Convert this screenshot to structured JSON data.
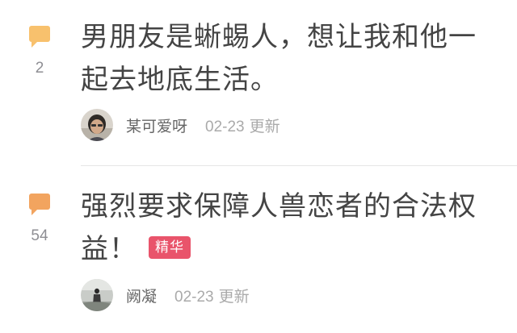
{
  "threads": [
    {
      "reply_icon": "comment-bubble-icon",
      "reply_count": "2",
      "title": "男朋友是蜥蜴人，想让我和他一起去地底生活。",
      "badge": "",
      "author": "某可爱呀",
      "date": "02-23",
      "updated_label": "更新"
    },
    {
      "reply_icon": "comment-bubble-icon",
      "reply_count": "54",
      "title": "强烈要求保障人兽恋者的合法权益！",
      "badge": "精华",
      "author": "阙凝",
      "date": "02-23",
      "updated_label": "更新"
    }
  ],
  "colors": {
    "bubble_light": "#f8c16d",
    "bubble_dark": "#f2a45f",
    "badge_bg": "#e9546b",
    "title_text": "#444444",
    "meta_text": "#aaaaaa"
  }
}
